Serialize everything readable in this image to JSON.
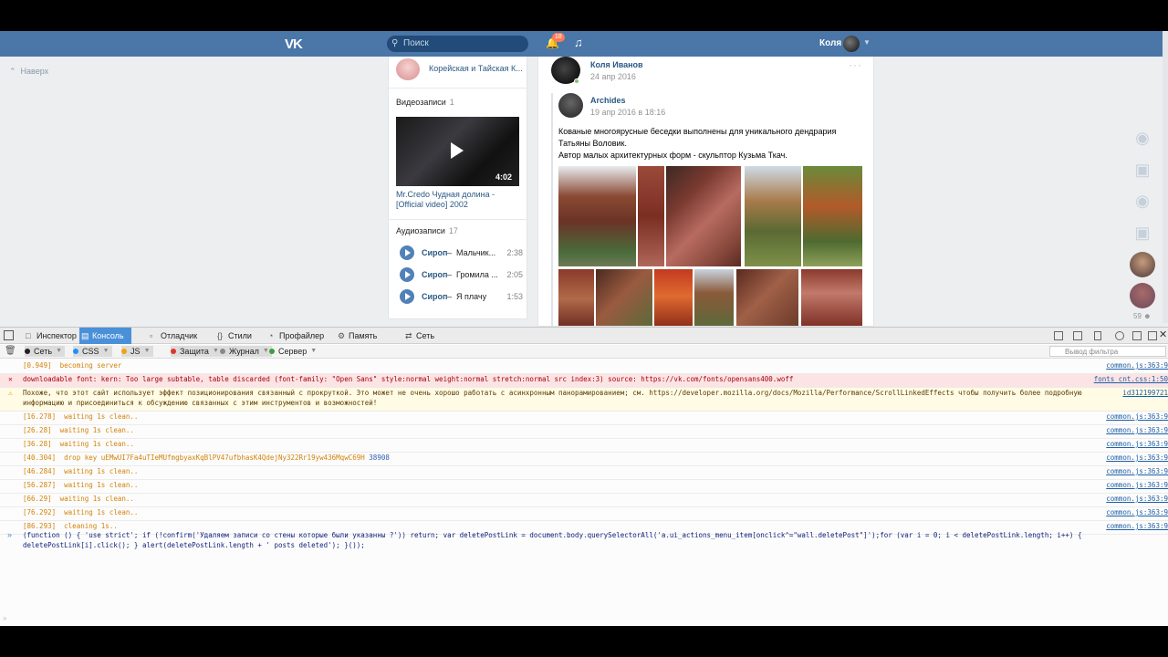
{
  "vk": {
    "logo": "VK",
    "search_placeholder": "Поиск",
    "notif_badge": "18",
    "username": "Коля",
    "back_to_top": "Наверх"
  },
  "left": {
    "group_name": "Корейская и Тайская К...",
    "videos_title": "Видеозаписи",
    "videos_count": "1",
    "video_duration": "4:02",
    "video_title": "Mr.Credo Чудная долина - [Official video] 2002",
    "audios_title": "Аудиозаписи",
    "audios_count": "17",
    "audios": [
      {
        "artist": "Сироп",
        "title": "Мальчик...",
        "time": "2:38"
      },
      {
        "artist": "Сироп",
        "title": "Громила ...",
        "time": "2:05"
      },
      {
        "artist": "Сироп",
        "title": "Я плачу",
        "time": "1:53"
      }
    ]
  },
  "post": {
    "author": "Коля Иванов",
    "date": "24 апр 2016",
    "repost_author": "Archides",
    "repost_date": "19 апр 2016 в 18:16",
    "text_1": "Кованые многоярусные беседки выполнены для уникального дендрария",
    "text_2": "Татьяны Воловик.",
    "text_3": "Автор малых архитектурных форм - скульптор Кузьма Ткач."
  },
  "side": {
    "count": "59"
  },
  "devtools": {
    "tabs": {
      "inspector": "Инспектор",
      "console": "Консоль",
      "debugger": "Отладчик",
      "styles": "Стили",
      "profiler": "Профайлер",
      "memory": "Память",
      "network": "Сеть"
    },
    "filters": {
      "net": "Сеть",
      "css": "CSS",
      "js": "JS",
      "security": "Защита",
      "log": "Журнал",
      "server": "Сервер",
      "filter_placeholder": "Вывод фильтра"
    },
    "colors": {
      "net": "#222222",
      "css": "#1e90ff",
      "js": "#f0a30a",
      "security": "#e0342b",
      "log": "#888888",
      "server": "#3aa040"
    },
    "lines": [
      {
        "type": "log",
        "msg": "[0.949]  becoming server",
        "src": "common.js:363:9"
      },
      {
        "type": "err",
        "msg": "downloadable font: kern: Too large subtable, table discarded (font-family: \"Open Sans\" style:normal weight:normal stretch:normal src index:3) source: https://vk.com/fonts/opensans400.woff",
        "src": "fonts_cnt.css:1:50"
      },
      {
        "type": "warn",
        "msg": "Похоже, что этот сайт использует эффект позиционирования связанный с прокруткой. Это может не очень хорошо работать с асинхронным панорамированием; см. https://developer.mozilla.org/docs/Mozilla/Performance/ScrollLinkedEffects чтобы получить более подробную информацию и присоединиться к обсуждению связанных с этим инструментов и возможностей!",
        "src": "id312199721"
      },
      {
        "type": "log",
        "msg": "[16.278]  waiting 1s clean..",
        "src": "common.js:363:9"
      },
      {
        "type": "log",
        "msg": "[26.28]  waiting 1s clean..",
        "src": "common.js:363:9"
      },
      {
        "type": "log",
        "msg": "[36.28]  waiting 1s clean..",
        "src": "common.js:363:9"
      },
      {
        "type": "log",
        "msg": "[40.304]  drop key uEMwUI7Fa4uTIeMUfmgbyaxKqBlPV47ufbhasK4QdejNy322Rr19yw436MqwC69H",
        "num": "38908",
        "src": "common.js:363:9"
      },
      {
        "type": "log",
        "msg": "[46.284]  waiting 1s clean..",
        "src": "common.js:363:9"
      },
      {
        "type": "log",
        "msg": "[56.287]  waiting 1s clean..",
        "src": "common.js:363:9"
      },
      {
        "type": "log",
        "msg": "[66.29]  waiting 1s clean..",
        "src": "common.js:363:9"
      },
      {
        "type": "log",
        "msg": "[76.292]  waiting 1s clean..",
        "src": "common.js:363:9"
      },
      {
        "type": "log",
        "msg": "[86.293]  cleaning 1s..",
        "src": "common.js:363:9"
      }
    ],
    "command": "(function () { 'use strict'; if (!confirm('Удаляем записи со стены которые были указанны ?')) return; var deletePostLink = document.body.querySelectorAll('a.ui_actions_menu_item[onclick^=\"wall.deletePost\"]');for (var i = 0; i < deletePostLink.length; i++) { deletePostLink[i].click(); } alert(deletePostLink.length + ' posts deleted'); }());"
  }
}
